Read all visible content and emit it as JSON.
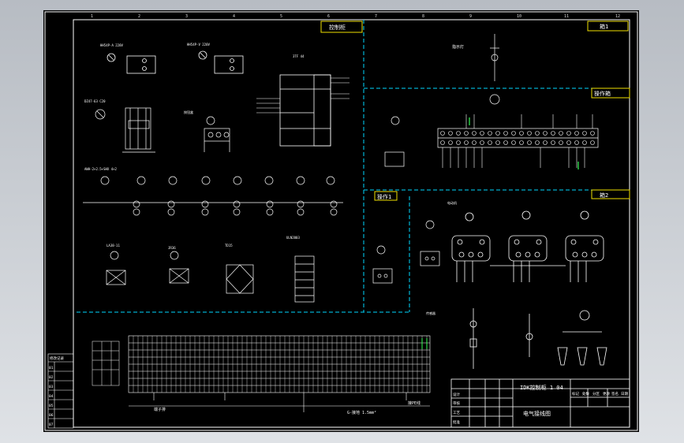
{
  "drawing": {
    "frame_numbers_top": [
      "1",
      "2",
      "3",
      "4",
      "5",
      "6",
      "7",
      "8",
      "9",
      "10",
      "11",
      "12"
    ],
    "panels": {
      "control_panel_tag": "控制柜",
      "box1_tag": "箱1",
      "box_top_right_tag": "操作箱",
      "box_small_tag": "操作1",
      "box_right_tag": "箱2"
    },
    "labels": {
      "relay1": "HH54P-A 220V",
      "relay2": "HH54P-V 220V",
      "contactor": "3TF 44",
      "breaker": "DZ47-63 C20",
      "button_set": "按钮盒",
      "cable_row": "AWH-2×2.5+SHX 4×2",
      "small1": "LA38-11",
      "small2": "JR36",
      "term_block": "TD15",
      "ic": "ULN2003",
      "motor_row": "电动机",
      "plc_left": "PLC",
      "bottom_label_a": "端子排",
      "bottom_label_b": "G-接地 1.5mm²",
      "bottom_label_c": "接PE线",
      "lamp": "指示灯",
      "title_left": "HL-2",
      "right_title": "5 UX",
      "sensor": "传感器"
    },
    "title_block": {
      "project": "IDK控制柜 1 04",
      "drawing_name": "电气接线图",
      "header_cells": [
        "标记",
        "处数",
        "分区",
        "更改",
        "签名",
        "日期"
      ],
      "rows": [
        "设计",
        "审核",
        "工艺",
        "批准"
      ]
    },
    "revision_table": {
      "title": "修改记录",
      "rows": [
        "01",
        "02",
        "03",
        "04",
        "05",
        "06",
        "07"
      ]
    }
  }
}
